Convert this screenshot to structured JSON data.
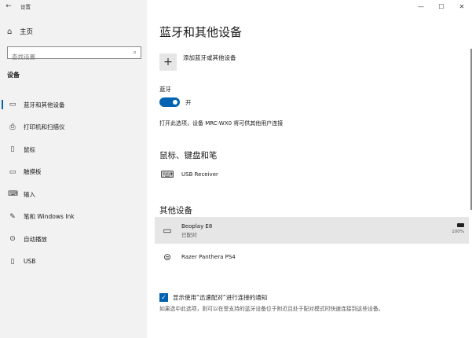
{
  "window": {
    "title": "设置",
    "back_glyph": "←",
    "min_glyph": "—",
    "max_glyph": "☐",
    "close_glyph": "✕"
  },
  "sidebar": {
    "home": {
      "icon": "home-icon",
      "label": "主页"
    },
    "search": {
      "placeholder": "查找设置",
      "value": ""
    },
    "section_title": "设备",
    "items": [
      {
        "icon": "bluetooth-devices-icon",
        "label": "蓝牙和其他设备",
        "active": true
      },
      {
        "icon": "printer-icon",
        "label": "打印机和扫描仪",
        "active": false
      },
      {
        "icon": "mouse-icon",
        "label": "鼠标",
        "active": false
      },
      {
        "icon": "touchpad-icon",
        "label": "触摸板",
        "active": false
      },
      {
        "icon": "keyboard-icon",
        "label": "输入",
        "active": false
      },
      {
        "icon": "pen-icon",
        "label": "笔和 Windows Ink",
        "active": false
      },
      {
        "icon": "autoplay-icon",
        "label": "自动播放",
        "active": false
      },
      {
        "icon": "usb-icon",
        "label": "USB",
        "active": false
      }
    ]
  },
  "main": {
    "title": "蓝牙和其他设备",
    "add_device": {
      "icon": "plus-icon",
      "label": "添加蓝牙或其他设备"
    },
    "bluetooth": {
      "label": "蓝牙",
      "toggle_state": "开",
      "on": true
    },
    "discoverable_text": "打开此选项，设备 MRC-WX0 将可供其他用户连接",
    "mouse_group": {
      "title": "鼠标、键盘和笔",
      "devices": [
        {
          "icon": "keyboard-icon",
          "name": "USB Receiver",
          "status": ""
        }
      ]
    },
    "other_group": {
      "title": "其他设备",
      "devices": [
        {
          "icon": "audio-device-icon",
          "name": "Beoplay E8",
          "status": "已配对",
          "battery": "100%",
          "selected": true
        },
        {
          "icon": "gamepad-icon",
          "name": "Razer Panthera PS4",
          "status": "",
          "selected": false
        }
      ]
    },
    "swift_pair": {
      "checked": true,
      "label": "显示使用“迅速配对”进行连接的通知",
      "description": "如果选中此选项，则可以在受支持的蓝牙设备位于附近且处于配对模式时快速连接到这些设备。"
    }
  },
  "colors": {
    "accent": "#0063b1",
    "sidebar_bg": "#f2f2f2",
    "selected_bg": "#e6e6e6"
  }
}
